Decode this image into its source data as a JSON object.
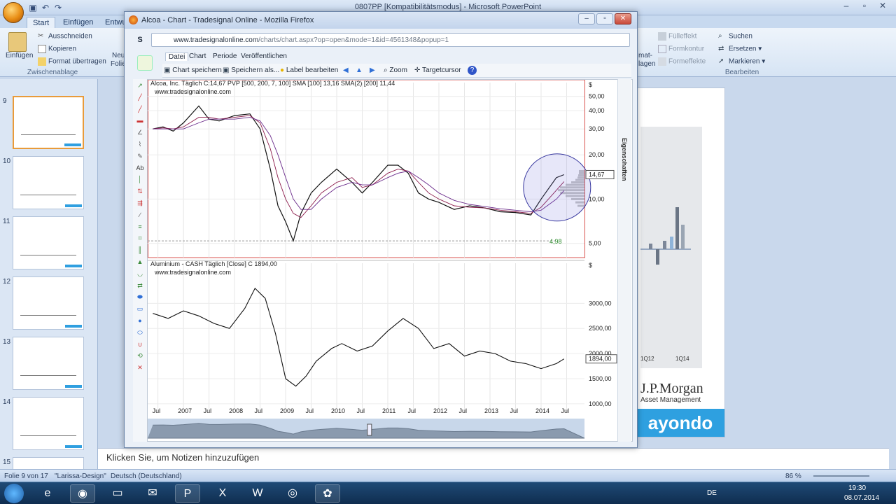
{
  "powerpoint": {
    "window_title": "0807PP [Kompatibilitätsmodus] - Microsoft PowerPoint",
    "tabs": [
      "Start",
      "Einfügen",
      "Entwu"
    ],
    "active_tab": "Start",
    "clipboard": {
      "paste_label": "Einfügen",
      "cut_label": "Ausschneiden",
      "copy_label": "Kopieren",
      "format_painter_label": "Format übertragen",
      "group_label": "Zwischenablage",
      "new_partial": "Neu",
      "folie_partial": "Folie"
    },
    "right_ribbon": {
      "fill_label": "Fülleffekt",
      "form_label": "Formkontur",
      "effects_label": "Formeffekte",
      "format_partial": "mat-",
      "format_partial2": "lagen",
      "search_label": "Suchen",
      "replace_label": "Ersetzen",
      "select_label": "Markieren",
      "edit_group_label": "Bearbeiten"
    },
    "thumbnails": [
      {
        "num": "9",
        "selected": true
      },
      {
        "num": "10",
        "selected": false
      },
      {
        "num": "11",
        "selected": false
      },
      {
        "num": "12",
        "selected": false
      },
      {
        "num": "13",
        "selected": false
      },
      {
        "num": "14",
        "selected": false
      },
      {
        "num": "15",
        "selected": false
      }
    ],
    "slide": {
      "axis_labels": [
        "1Q12",
        "1Q14"
      ],
      "jpmorgan": "J.P.Morgan",
      "asset_mgmt": "Asset Management",
      "ayondo": "ayondo"
    },
    "notes_placeholder": "Klicken Sie, um Notizen hinzuzufügen",
    "status": {
      "slide_info": "Folie 9 von 17",
      "design": "\"Larissa-Design\"",
      "language": "Deutsch (Deutschland)",
      "zoom": "86 %"
    }
  },
  "taskbar": {
    "language": "DE",
    "time": "19:30",
    "date": "08.07.2014"
  },
  "firefox": {
    "title": "Alcoa - Chart - Tradesignal Online - Mozilla Firefox",
    "url_host": "www.tradesignalonline.com",
    "url_path": "/charts/chart.aspx?op=open&mode=1&id=4561348&popup=1",
    "app_letter": "S"
  },
  "tradesignal": {
    "menu": [
      "Datei",
      "Chart",
      "Periode",
      "Veröffentlichen"
    ],
    "active_menu": "Datei",
    "toolbar": {
      "save_chart": "Chart speichern",
      "save_as": "Speichern als...",
      "edit_label": "Label bearbeiten",
      "zoom": "Zoom",
      "target_cursor": "Targetcursor"
    },
    "properties_label": "Eigenschaften"
  },
  "chart_data": [
    {
      "type": "line",
      "title": "Alcoa, Inc.",
      "period": "Täglich",
      "close_label": "C:14,67",
      "indicators": [
        {
          "label": "PVP [500, 200, 7, 100]"
        },
        {
          "label": "SMA [100]",
          "value": "13,16"
        },
        {
          "label": "SMA(2) [200]",
          "value": "11,44"
        }
      ],
      "source": "www.tradesignalonline.com",
      "currency": "$",
      "y_scale": "log",
      "ylim": [
        4.0,
        62.0
      ],
      "y_ticks": [
        "50,00",
        "40,00",
        "30,00",
        "20,00",
        "10,00",
        "5,00"
      ],
      "last_value_label": "14,67",
      "low_label": "4,98",
      "x": [
        2006.4,
        2006.6,
        2006.8,
        2007.0,
        2007.3,
        2007.5,
        2007.7,
        2008.0,
        2008.3,
        2008.5,
        2008.7,
        2008.85,
        2009.0,
        2009.15,
        2009.3,
        2009.5,
        2009.7,
        2010.0,
        2010.3,
        2010.5,
        2010.7,
        2011.0,
        2011.2,
        2011.4,
        2011.6,
        2011.8,
        2012.0,
        2012.3,
        2012.6,
        2012.9,
        2013.2,
        2013.5,
        2013.8,
        2014.0,
        2014.3,
        2014.45
      ],
      "series": [
        {
          "name": "Alcoa",
          "values": [
            30,
            31,
            29,
            33,
            43,
            35,
            34,
            37,
            38,
            30,
            16,
            9,
            7,
            5.2,
            8,
            11,
            13,
            16,
            13,
            11,
            13,
            17,
            17,
            15,
            11,
            10,
            9.5,
            8.5,
            9,
            8.7,
            8.2,
            8.1,
            7.8,
            10,
            14,
            14.67
          ]
        },
        {
          "name": "SMA [100]",
          "values": [
            30,
            30.5,
            30,
            31,
            36,
            36,
            35,
            36,
            37,
            33,
            22,
            14,
            10,
            8,
            7.5,
            9,
            11,
            13,
            14,
            12,
            12.5,
            15,
            16,
            15.5,
            13,
            11,
            10,
            9,
            8.8,
            8.7,
            8.4,
            8.2,
            8,
            8.8,
            11.5,
            13.16
          ]
        },
        {
          "name": "SMA(2) [200]",
          "values": [
            30,
            30,
            30,
            30,
            33,
            35,
            35,
            35,
            36,
            34,
            27,
            20,
            14,
            10,
            8.5,
            8.5,
            10,
            12,
            13,
            12.5,
            12.5,
            14,
            15,
            15.5,
            14,
            12.5,
            11,
            9.8,
            9.2,
            8.9,
            8.6,
            8.4,
            8.2,
            8.4,
            10,
            11.44
          ]
        }
      ]
    },
    {
      "type": "line",
      "title": "Aluminium - CASH",
      "period": "Täglich [Close]",
      "close_label": "C 1894,00",
      "source": "www.tradesignalonline.com",
      "currency": "$",
      "ylim": [
        900,
        3800
      ],
      "y_ticks": [
        "3000,00",
        "2500,00",
        "2000,00",
        "1500,00",
        "1000,00"
      ],
      "last_value_label": "1894,00",
      "x": [
        2006.4,
        2006.7,
        2007.0,
        2007.3,
        2007.6,
        2007.9,
        2008.2,
        2008.4,
        2008.6,
        2008.8,
        2009.0,
        2009.2,
        2009.4,
        2009.6,
        2009.9,
        2010.1,
        2010.4,
        2010.7,
        2011.0,
        2011.3,
        2011.6,
        2011.9,
        2012.2,
        2012.5,
        2012.8,
        2013.1,
        2013.4,
        2013.7,
        2014.0,
        2014.3,
        2014.45
      ],
      "values": [
        2800,
        2700,
        2850,
        2750,
        2600,
        2500,
        2900,
        3300,
        3100,
        2400,
        1500,
        1350,
        1550,
        1850,
        2100,
        2200,
        2050,
        2150,
        2450,
        2700,
        2500,
        2100,
        2200,
        1950,
        2050,
        2000,
        1850,
        1800,
        1700,
        1800,
        1894
      ]
    }
  ],
  "x_axis": {
    "labels": [
      "Jul",
      "2007",
      "Jul",
      "2008",
      "Jul",
      "2009",
      "Jul",
      "2010",
      "Jul",
      "2011",
      "Jul",
      "2012",
      "Jul",
      "2013",
      "Jul",
      "2014",
      "Jul"
    ],
    "range": [
      2006.3,
      2014.85
    ]
  }
}
